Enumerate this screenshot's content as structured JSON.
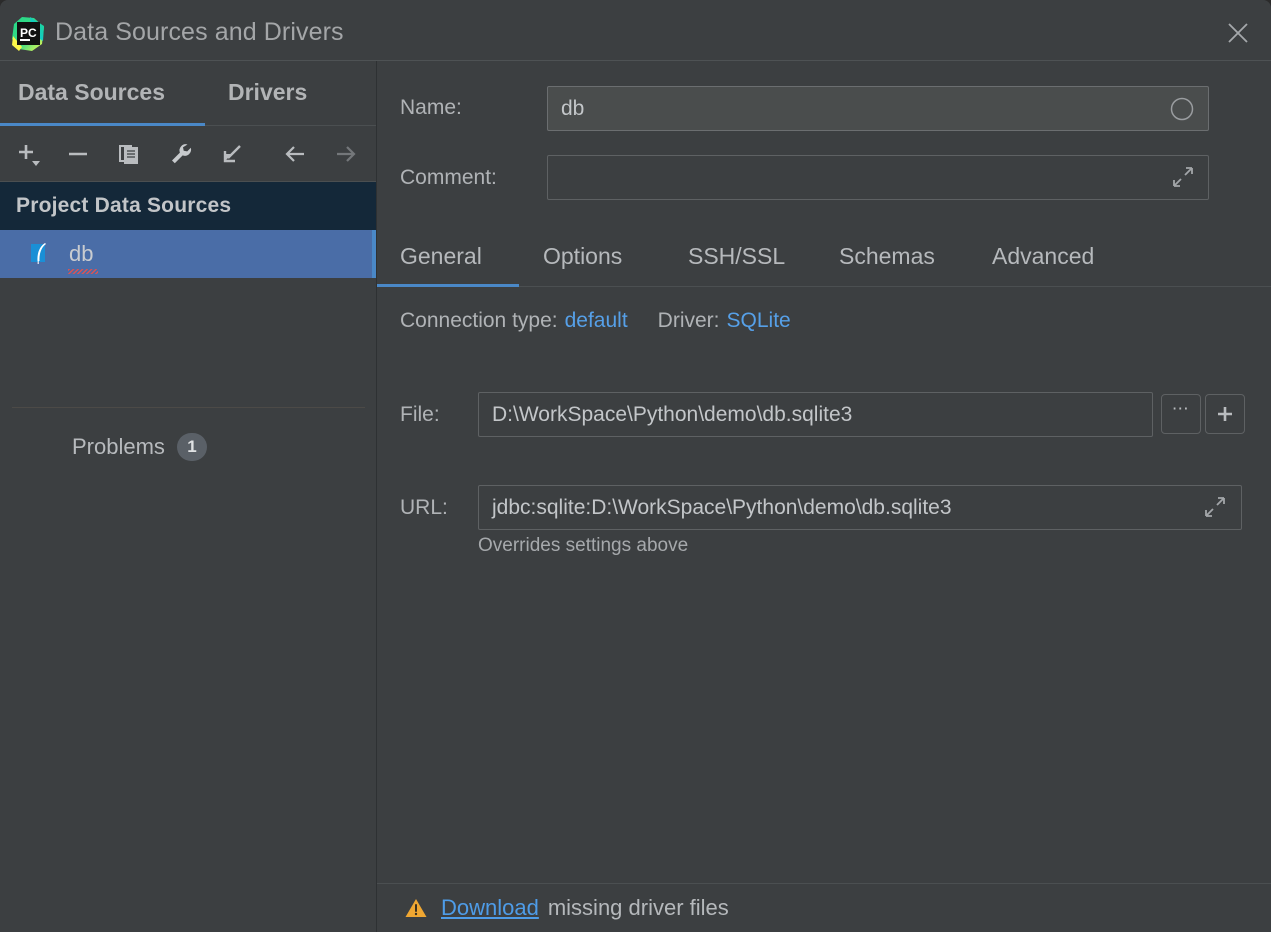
{
  "window": {
    "title": "Data Sources and Drivers",
    "logo_icon": "pycharm-logo-icon",
    "close_icon": "close-icon"
  },
  "sidebar": {
    "tabs": [
      {
        "label": "Data Sources",
        "active": true
      },
      {
        "label": "Drivers",
        "active": false
      }
    ],
    "toolbar": [
      {
        "name": "add-button",
        "icon": "plus-dropdown-icon",
        "enabled": true
      },
      {
        "name": "remove-button",
        "icon": "minus-icon",
        "enabled": true
      },
      {
        "name": "duplicate-button",
        "icon": "copy-icon",
        "enabled": true
      },
      {
        "name": "properties-button",
        "icon": "wrench-icon",
        "enabled": true
      },
      {
        "name": "import-button",
        "icon": "import-arrow-icon",
        "enabled": true
      },
      {
        "name": "back-button",
        "icon": "arrow-left-icon",
        "enabled": true
      },
      {
        "name": "forward-button",
        "icon": "arrow-right-icon",
        "enabled": false
      }
    ],
    "tree_header": "Project Data Sources",
    "tree_items": [
      {
        "label": "db",
        "icon": "sqlite-feather-icon",
        "selected": true,
        "has_error": true
      }
    ],
    "problems": {
      "label": "Problems",
      "count": "1"
    }
  },
  "form": {
    "name": {
      "label": "Name:",
      "value": "db",
      "adorn_icon": "circle-icon"
    },
    "comment": {
      "label": "Comment:",
      "value": "",
      "adorn_icon": "expand-diagonal-icon"
    },
    "tabs": [
      {
        "label": "General",
        "active": true
      },
      {
        "label": "Options",
        "active": false
      },
      {
        "label": "SSH/SSL",
        "active": false
      },
      {
        "label": "Schemas",
        "active": false
      },
      {
        "label": "Advanced",
        "active": false
      }
    ],
    "connection": {
      "type_label": "Connection type:",
      "type_value": "default",
      "driver_label": "Driver:",
      "driver_value": "SQLite"
    },
    "file": {
      "label": "File:",
      "value": "D:\\WorkSpace\\Python\\demo\\db.sqlite3",
      "browse_label": "⋯",
      "add_label": "+"
    },
    "url": {
      "label": "URL:",
      "value": "jdbc:sqlite:D:\\WorkSpace\\Python\\demo\\db.sqlite3",
      "adorn_icon": "expand-diagonal-icon",
      "hint": "Overrides settings above"
    }
  },
  "footer": {
    "warn_icon": "warning-triangle-icon",
    "link": "Download",
    "rest": "missing driver files"
  },
  "colors": {
    "background": "#3c3f41",
    "accent_blue": "#4a88c7",
    "link_blue": "#56a0e8",
    "selection_blue": "#4a6da7",
    "tree_header_navy": "#142839",
    "warning_amber": "#f0a732",
    "error_red": "#e05252"
  }
}
